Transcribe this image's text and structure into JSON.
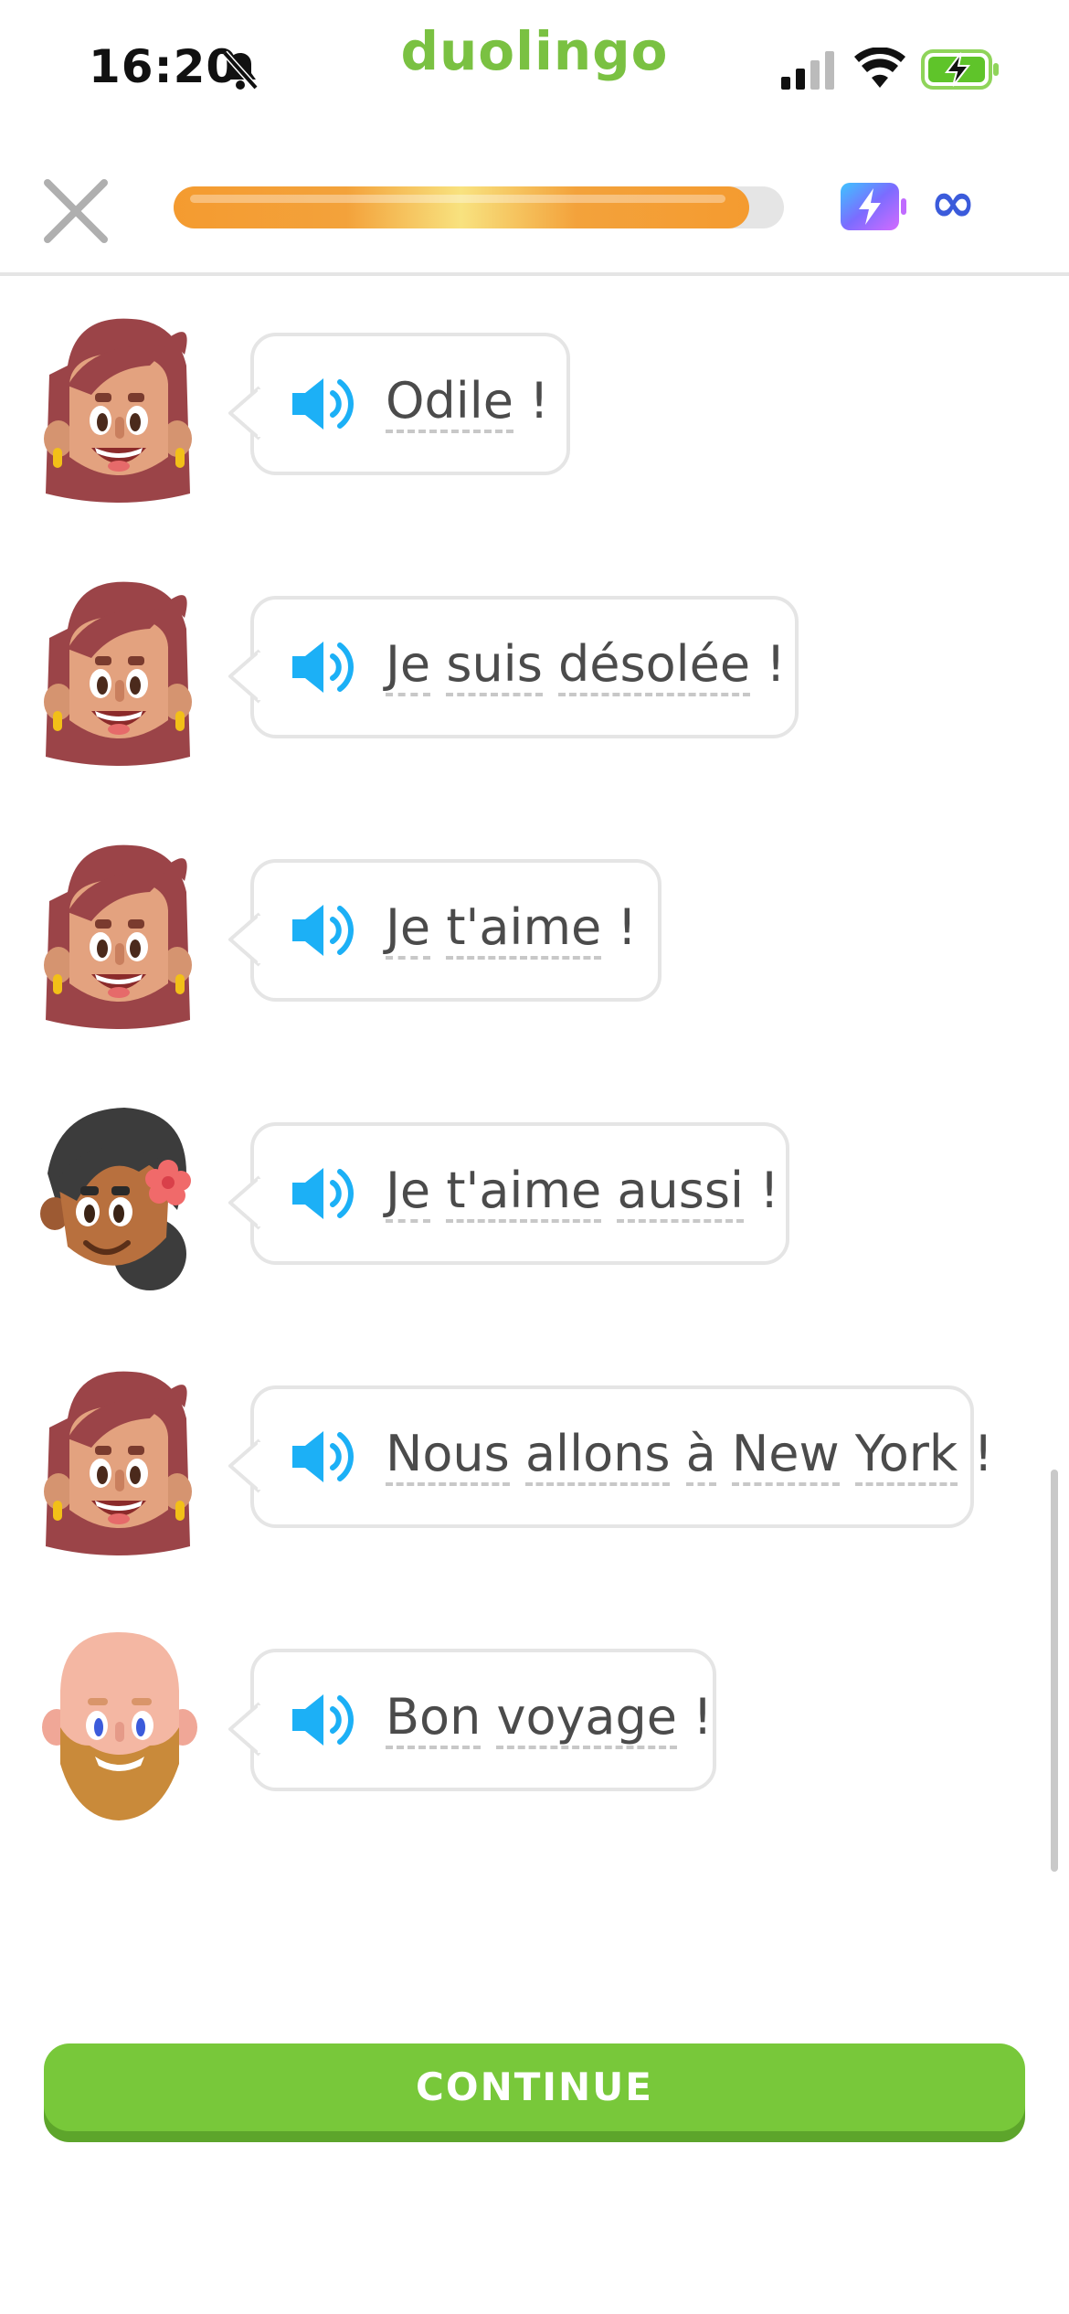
{
  "status_bar": {
    "time": "16:20",
    "brand": "duolingo"
  },
  "lesson": {
    "progress_fraction": 0.985,
    "energy_label": "∞"
  },
  "dialogue": [
    {
      "speaker_avatar": "woman-red-hair",
      "words": [
        "Odile",
        "!"
      ]
    },
    {
      "speaker_avatar": "woman-red-hair",
      "words": [
        "Je",
        "suis",
        "désolée",
        "!"
      ]
    },
    {
      "speaker_avatar": "woman-red-hair",
      "words": [
        "Je",
        "t'aime",
        "!"
      ]
    },
    {
      "speaker_avatar": "woman-black-hair-flower",
      "words": [
        "Je",
        "t'aime",
        "aussi",
        "!"
      ]
    },
    {
      "speaker_avatar": "woman-red-hair",
      "words": [
        "Nous",
        "allons",
        "à",
        "New",
        "York",
        "!"
      ]
    },
    {
      "speaker_avatar": "bald-man-beard",
      "words": [
        "Bon",
        "voyage",
        "!"
      ]
    }
  ],
  "footer": {
    "continue_label": "CONTINUE"
  },
  "colors": {
    "brand_green": "#7ac142",
    "button_green": "#78c83a",
    "progress_orange": "#f49b30",
    "speaker_blue": "#1cb0f6"
  }
}
